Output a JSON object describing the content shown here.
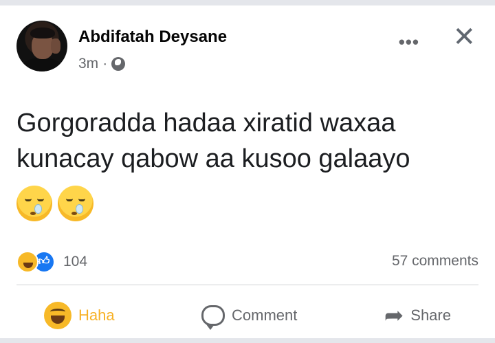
{
  "post": {
    "author": "Abdifatah Deysane",
    "time": "3m",
    "separator": "·",
    "text_lines": [
      "Gorgoradda hadaa xiratid waxaa",
      "kunacay qabow aa kusoo galaayo"
    ],
    "emojis": [
      "sneezing-face-icon",
      "sneezing-face-icon"
    ]
  },
  "header": {
    "more_label": "•••",
    "close_label": "✕"
  },
  "stats": {
    "reaction_icons": [
      "haha-icon",
      "like-icon"
    ],
    "reaction_count": "104",
    "comments": "57 comments"
  },
  "actions": {
    "haha": "Haha",
    "comment": "Comment",
    "share": "Share"
  },
  "colors": {
    "haha_active": "#f7b125",
    "like_blue": "#1877f2",
    "secondary_text": "#65676b"
  }
}
